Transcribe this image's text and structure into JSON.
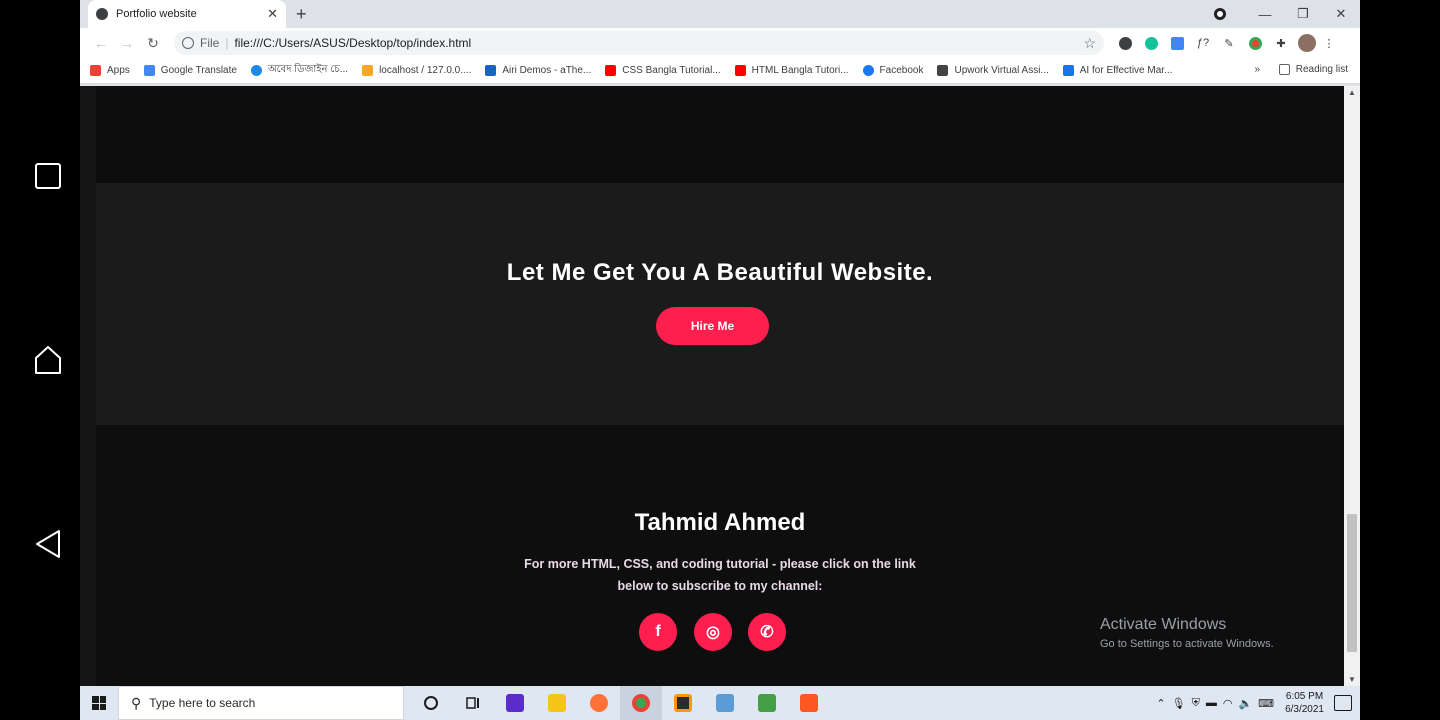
{
  "browser": {
    "tab_title": "Portfolio website",
    "new_tab": "+",
    "omnibox_scheme": "File",
    "omnibox_url": "file:///C:/Users/ASUS/Desktop/top/index.html"
  },
  "bookmarks": [
    {
      "label": "Apps",
      "color": "#ea4335"
    },
    {
      "label": "Google Translate",
      "color": "#4285f4"
    },
    {
      "label": "অবেদ ডিজাইন চে...",
      "color": "#1e88e5"
    },
    {
      "label": "localhost / 127.0.0....",
      "color": "#f9a825"
    },
    {
      "label": "Airi Demos - aThe...",
      "color": "#1565c0"
    },
    {
      "label": "CSS Bangla Tutorial...",
      "color": "#ff0000"
    },
    {
      "label": "HTML Bangla Tutori...",
      "color": "#ff0000"
    },
    {
      "label": "Facebook",
      "color": "#1877f2"
    },
    {
      "label": "Upwork Virtual Assi...",
      "color": "#444444"
    },
    {
      "label": "AI for Effective Mar...",
      "color": "#1a73e8"
    }
  ],
  "bookmarks_more": "»",
  "reading_list": "Reading list",
  "page": {
    "hire_title": "Let Me Get You A Beautiful Website.",
    "hire_button": "Hire Me",
    "footer_name": "Tahmid Ahmed",
    "footer_text": "For more HTML, CSS, and coding tutorial - please click on the link below to subscribe to my channel:",
    "social": {
      "facebook": "f",
      "dribbble": "◎",
      "whatsapp": "✆"
    },
    "accent_color": "#ff1f4f"
  },
  "watermark": {
    "title": "Activate Windows",
    "subtitle": "Go to Settings to activate Windows."
  },
  "taskbar": {
    "search_placeholder": "Type here to search",
    "time": "6:05 PM",
    "date": "6/3/2021"
  }
}
